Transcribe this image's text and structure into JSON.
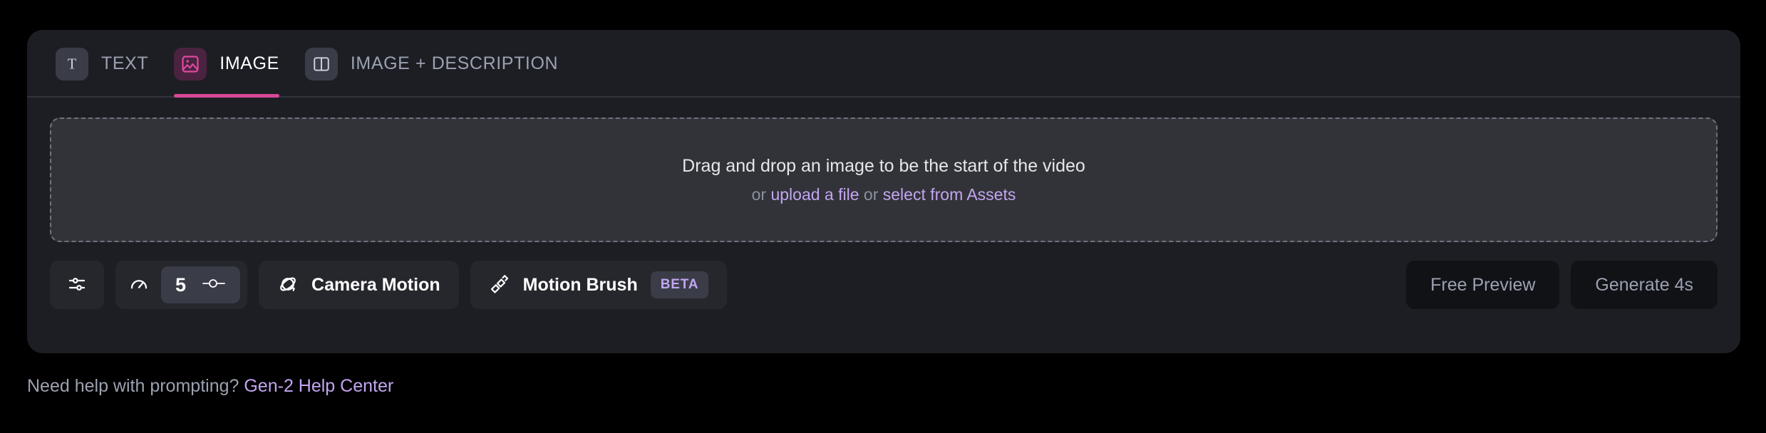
{
  "tabs": [
    {
      "label": "TEXT",
      "icon": "text-icon",
      "active": false
    },
    {
      "label": "IMAGE",
      "icon": "image-icon",
      "active": true
    },
    {
      "label": "IMAGE + DESCRIPTION",
      "icon": "image-description-icon",
      "active": false
    }
  ],
  "dropzone": {
    "main_text": "Drag and drop an image to be the start of the video",
    "or_prefix": "or ",
    "upload_link": "upload a file",
    "or_middle": " or ",
    "assets_link": "select from Assets"
  },
  "toolbar": {
    "settings_icon": "sliders-icon",
    "motion": {
      "gauge_icon": "gauge-icon",
      "value": "5",
      "slider_icon": "slider-handle-icon"
    },
    "camera_motion": {
      "label": "Camera Motion",
      "icon": "orbit-icon"
    },
    "motion_brush": {
      "label": "Motion Brush",
      "icon": "paintbrush-icon",
      "badge": "BETA"
    },
    "free_preview_label": "Free Preview",
    "generate_label": "Generate 4s"
  },
  "footer": {
    "text": "Need help with prompting? ",
    "link": "Gen-2 Help Center"
  },
  "colors": {
    "accent_pink": "#d94896",
    "accent_purple": "#c3a5f2",
    "panel_bg": "#1d1e24",
    "page_bg": "#000000"
  }
}
